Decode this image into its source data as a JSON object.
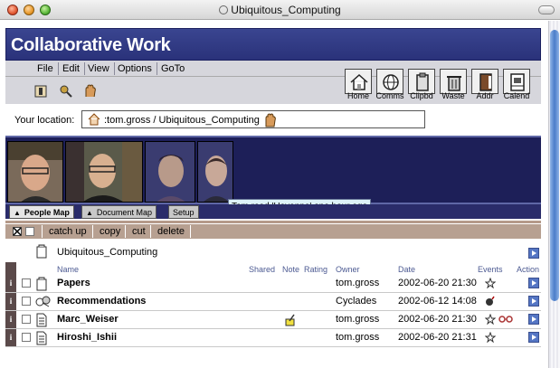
{
  "window": {
    "title": "Ubiquitous_Computing"
  },
  "app": {
    "title": "Collaborative Work"
  },
  "menu": [
    "File",
    "Edit",
    "View",
    "Options",
    "GoTo"
  ],
  "toolbar": {
    "buttons": [
      {
        "label": "Home",
        "icon": "home-icon"
      },
      {
        "label": "Comms",
        "icon": "globe-icon"
      },
      {
        "label": "Clipbd",
        "icon": "clipboard-icon"
      },
      {
        "label": "Waste",
        "icon": "trash-icon"
      },
      {
        "label": "Addr",
        "icon": "address-book-icon"
      },
      {
        "label": "Calend",
        "icon": "calendar-icon"
      }
    ]
  },
  "location": {
    "label": "Your location:",
    "path": ":tom.gross / Ubiquitous_Computing"
  },
  "awareness": {
    "tooltip": "Tom read 'Havanna' one hour ago"
  },
  "tabs": [
    "People Map",
    "Document Map",
    "Setup"
  ],
  "actions": [
    "catch up",
    "copy",
    "cut",
    "delete"
  ],
  "folder": {
    "name": "Ubiquitous_Computing"
  },
  "columns": {
    "name": "Name",
    "shared": "Shared",
    "note": "Note",
    "rating": "Rating",
    "owner": "Owner",
    "date": "Date",
    "events": "Events",
    "action": "Action"
  },
  "rows": [
    {
      "name": "Papers",
      "owner": "tom.gross",
      "date": "2002-06-20 21:30",
      "type": "folder"
    },
    {
      "name": "Recommendations",
      "owner": "Cyclades",
      "date": "2002-06-12 14:08",
      "type": "recommend"
    },
    {
      "name": "Marc_Weiser",
      "owner": "tom.gross",
      "date": "2002-06-20 21:30",
      "type": "doc"
    },
    {
      "name": "Hiroshi_Ishii",
      "owner": "tom.gross",
      "date": "2002-06-20 21:31",
      "type": "doc"
    }
  ],
  "colors": {
    "header": "#2a327a",
    "actionbar": "#b7a091",
    "banner": "#1d1f58"
  }
}
